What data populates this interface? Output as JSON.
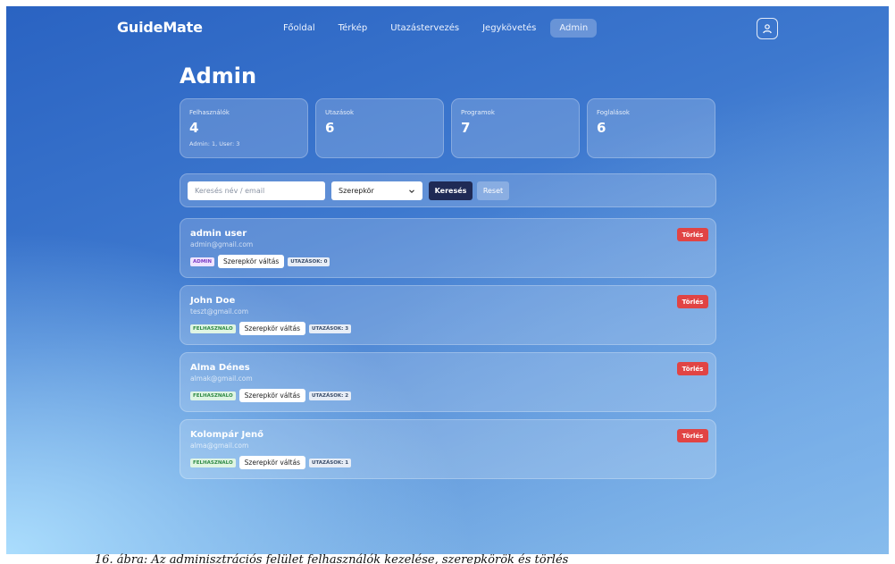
{
  "nav": {
    "brand": "GuideMate",
    "links": [
      "Főoldal",
      "Térkép",
      "Utazástervezés",
      "Jegykövetés",
      "Admin"
    ],
    "active_index": 4,
    "profile_icon": "user-icon"
  },
  "page": {
    "title": "Admin"
  },
  "stats": [
    {
      "label": "Felhasználók",
      "value": "4",
      "sub": "Admin: 1, User: 3"
    },
    {
      "label": "Utazások",
      "value": "6",
      "sub": ""
    },
    {
      "label": "Programok",
      "value": "7",
      "sub": ""
    },
    {
      "label": "Foglalások",
      "value": "6",
      "sub": ""
    }
  ],
  "filter": {
    "search_placeholder": "Keresés név / email",
    "role_select_value": "Szerepkör",
    "search_button": "Keresés",
    "reset_button": "Reset"
  },
  "users": [
    {
      "name": "admin user",
      "email": "admin@gmail.com",
      "role": "ADMIN",
      "toggle": "Szerepkör váltás",
      "trips": "UTAZÁSOK: 0",
      "delete": "Törlés"
    },
    {
      "name": "John Doe",
      "email": "teszt@gmail.com",
      "role": "FELHASZNALO",
      "toggle": "Szerepkör váltás",
      "trips": "UTAZÁSOK: 3",
      "delete": "Törlés"
    },
    {
      "name": "Alma Dénes",
      "email": "almak@gmail.com",
      "role": "FELHASZNALO",
      "toggle": "Szerepkör váltás",
      "trips": "UTAZÁSOK: 2",
      "delete": "Törlés"
    },
    {
      "name": "Kolompár Jenő",
      "email": "alma@gmail.com",
      "role": "FELHASZNALO",
      "toggle": "Szerepkör váltás",
      "trips": "UTAZÁSOK: 1",
      "delete": "Törlés"
    }
  ],
  "caption": "16. ábra: Az adminisztrációs felület felhasználók kezelése, szerepkörök és törlés"
}
